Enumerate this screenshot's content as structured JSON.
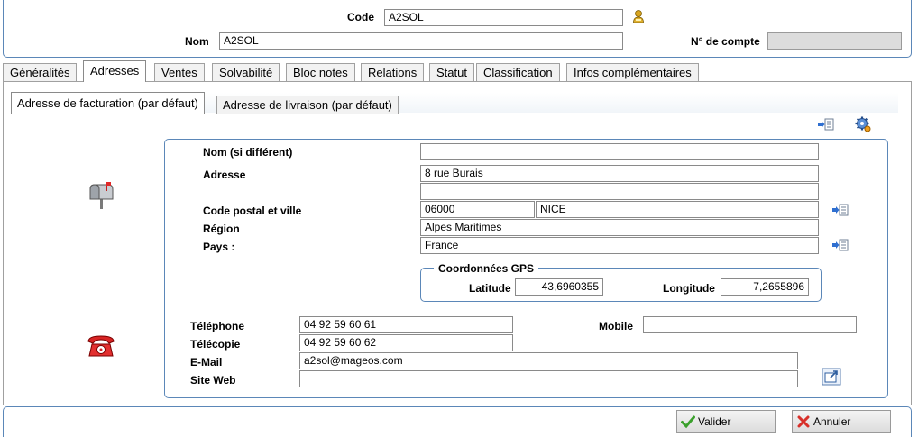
{
  "header": {
    "code_label": "Code",
    "code_value": "A2SOL",
    "nom_label": "Nom",
    "nom_value": "A2SOL",
    "compte_label": "N° de compte",
    "compte_value": ""
  },
  "tabs": [
    {
      "label": "Généralités"
    },
    {
      "label": "Adresses",
      "active": true
    },
    {
      "label": "Ventes"
    },
    {
      "label": "Solvabilité"
    },
    {
      "label": "Bloc notes"
    },
    {
      "label": "Relations"
    },
    {
      "label": "Statut"
    },
    {
      "label": "Classification"
    },
    {
      "label": "Infos complémentaires"
    }
  ],
  "subtabs": [
    {
      "label": "Adresse de facturation (par défaut)",
      "active": true
    },
    {
      "label": "Adresse de livraison (par défaut)"
    }
  ],
  "address": {
    "nom_label": "Nom (si différent)",
    "nom_value": "",
    "adresse_label": "Adresse",
    "adresse_line1": "8 rue Burais",
    "adresse_line2": "",
    "cp_label": "Code postal et ville",
    "cp_value": "06000",
    "ville_value": "NICE",
    "region_label": "Région",
    "region_value": "Alpes Maritimes",
    "pays_label": "Pays :",
    "pays_value": "France"
  },
  "gps": {
    "title": "Coordonnées GPS",
    "lat_label": "Latitude",
    "lat_value": "43,6960355",
    "lon_label": "Longitude",
    "lon_value": "7,2655896"
  },
  "contact": {
    "tel_label": "Téléphone",
    "tel_value": "04 92 59 60 61",
    "mobile_label": "Mobile",
    "mobile_value": "",
    "fax_label": "Télécopie",
    "fax_value": "04 92 59 60 62",
    "email_label": "E-Mail",
    "email_value": "a2sol@mageos.com",
    "web_label": "Site Web",
    "web_value": ""
  },
  "footer": {
    "valider_label": "Valider",
    "annuler_label": "Annuler"
  },
  "colors": {
    "panel_border": "#5b87b8",
    "valider_check": "#3aa02c",
    "annuler_cross": "#d8302a"
  }
}
